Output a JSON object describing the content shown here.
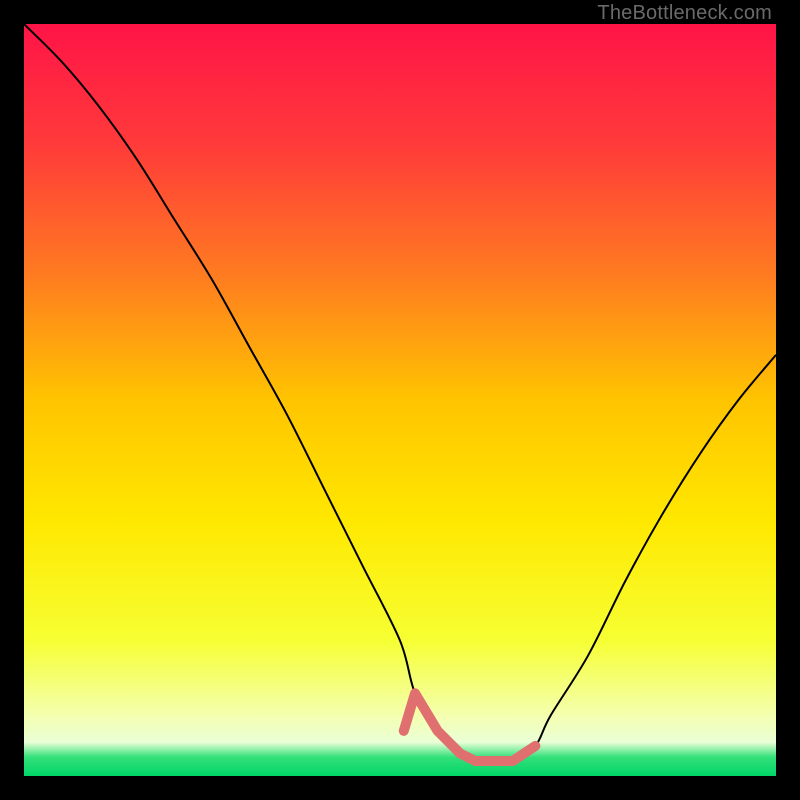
{
  "watermark": "TheBottleneck.com",
  "chart_data": {
    "type": "line",
    "title": "",
    "xlabel": "",
    "ylabel": "",
    "xlim": [
      0,
      100
    ],
    "ylim": [
      0,
      100
    ],
    "x": [
      0,
      5,
      10,
      15,
      20,
      25,
      30,
      35,
      40,
      45,
      50,
      52,
      55,
      58,
      60,
      62,
      65,
      68,
      70,
      75,
      80,
      85,
      90,
      95,
      100
    ],
    "values": [
      100,
      95,
      89,
      82,
      74,
      66,
      57,
      48,
      38,
      28,
      18,
      11,
      6,
      3,
      2,
      2,
      2,
      4,
      8,
      16,
      26,
      35,
      43,
      50,
      56
    ],
    "minimum_band": {
      "x_start": 52,
      "x_end": 68,
      "y": 2
    },
    "gradient_stops": [
      {
        "pos": 0.0,
        "color": "#ff1447"
      },
      {
        "pos": 0.16,
        "color": "#ff3a3a"
      },
      {
        "pos": 0.33,
        "color": "#ff7a21"
      },
      {
        "pos": 0.5,
        "color": "#ffc400"
      },
      {
        "pos": 0.66,
        "color": "#ffe800"
      },
      {
        "pos": 0.82,
        "color": "#f6ff33"
      },
      {
        "pos": 0.92,
        "color": "#f4ffb0"
      },
      {
        "pos": 0.955,
        "color": "#eaffd6"
      },
      {
        "pos": 0.975,
        "color": "#33e07a"
      },
      {
        "pos": 1.0,
        "color": "#00d566"
      }
    ],
    "highlight_color": "#e07070",
    "curve_color": "#000000"
  }
}
